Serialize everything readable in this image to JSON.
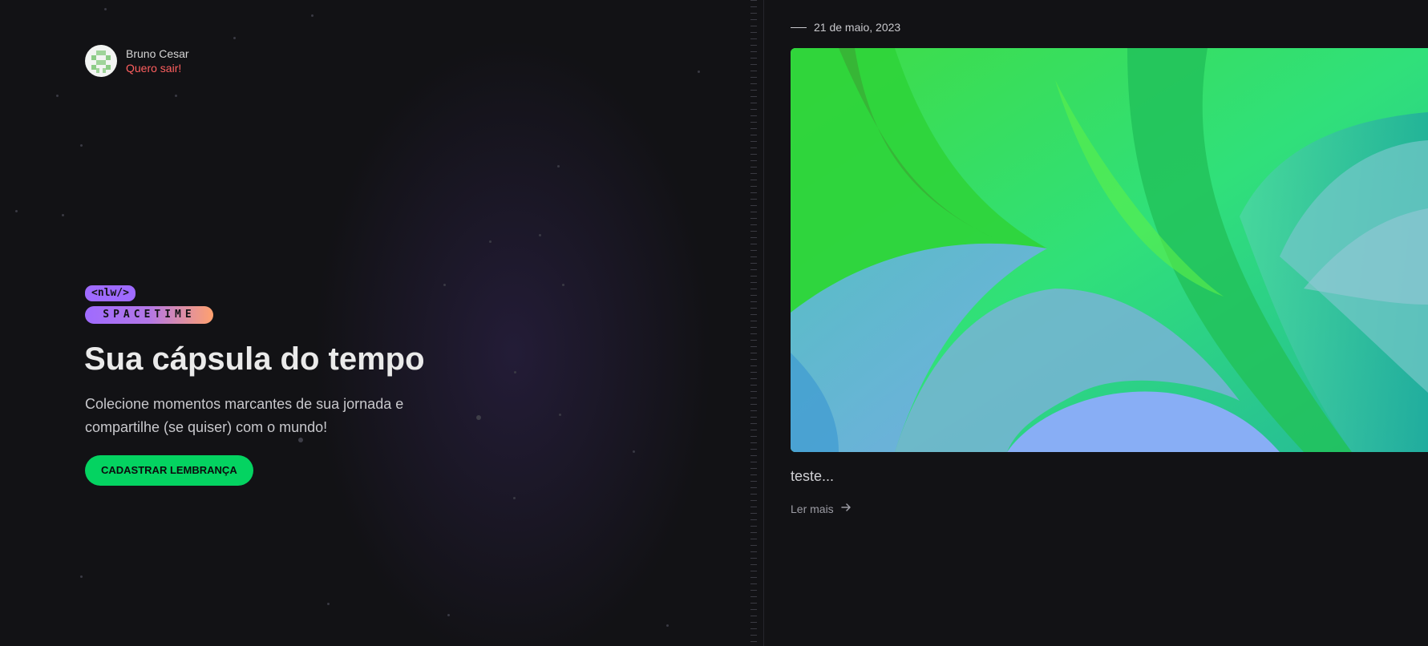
{
  "user": {
    "name": "Bruno Cesar",
    "logout_label": "Quero sair!"
  },
  "logo": {
    "top": "<nlw/>",
    "bottom": "SPACETIME"
  },
  "hero": {
    "title": "Sua cápsula do tempo",
    "description": "Colecione momentos marcantes de sua jornada e compartilhe (se quiser) com o mundo!",
    "cta_label": "CADASTRAR LEMBRANÇA"
  },
  "memory": {
    "date": "21 de maio, 2023",
    "excerpt": "teste...",
    "read_more_label": "Ler mais"
  },
  "icons": {
    "read_more": "arrow-right-icon",
    "avatar": "user-avatar"
  },
  "colors": {
    "accent_green": "#04d361",
    "logout_red": "#ff5f5f",
    "brand_purple": "#9f6bff",
    "brand_orange": "#ffa16e"
  }
}
